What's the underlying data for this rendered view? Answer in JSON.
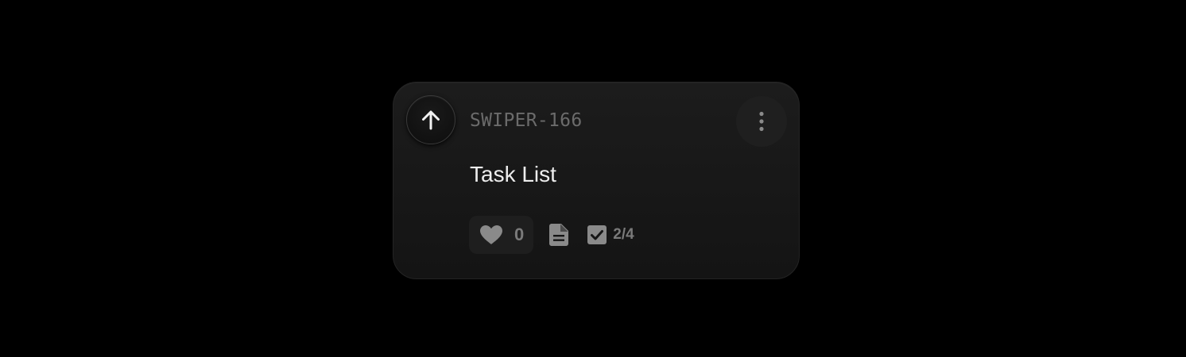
{
  "card": {
    "issue_id": "SWIPER-166",
    "title": "Task List",
    "priority_icon": "arrow-up-icon",
    "menu_icon": "vertical-ellipsis-icon",
    "likes": {
      "icon": "heart-icon",
      "count": "0"
    },
    "description_icon": "document-icon",
    "checklist": {
      "icon": "checkbox-icon",
      "progress": "2/4",
      "completed": 2,
      "total": 4
    }
  },
  "colors": {
    "background": "#000000",
    "card": "#161616",
    "muted_text": "#6b6b6b",
    "title_text": "#ededed",
    "icon": "#8a8a8a"
  }
}
